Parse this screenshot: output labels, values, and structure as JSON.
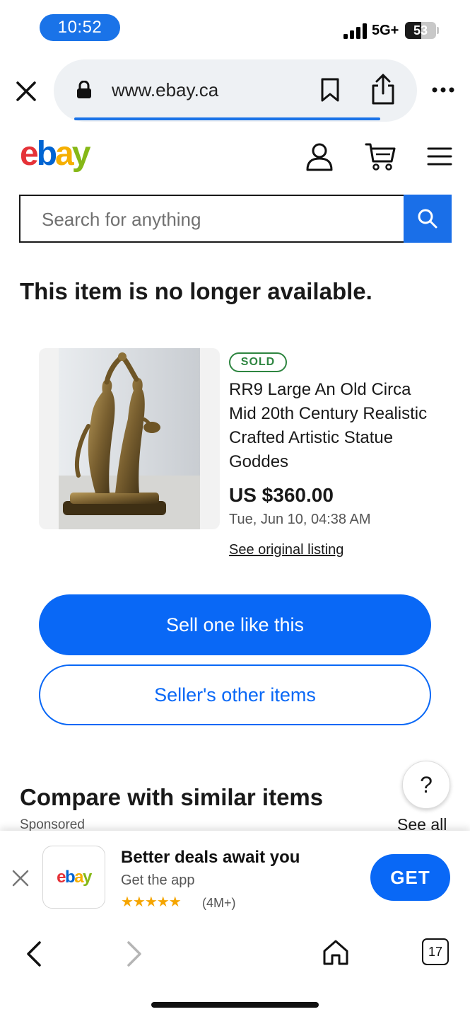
{
  "status_bar": {
    "time": "10:52",
    "network": "5G+",
    "battery": "53",
    "battery_level": 0.53
  },
  "browser": {
    "url": "www.ebay.ca"
  },
  "header": {
    "logo_letters": [
      {
        "char": "e",
        "color": "#e53238"
      },
      {
        "char": "b",
        "color": "#0064d2"
      },
      {
        "char": "a",
        "color": "#f5af02"
      },
      {
        "char": "y",
        "color": "#86b817"
      }
    ]
  },
  "search": {
    "placeholder": "Search for anything"
  },
  "page": {
    "title": "This item is no longer available."
  },
  "item": {
    "badge": "SOLD",
    "title": "RR9 Large An Old Circa Mid 20th Century Realistic Crafted Artistic Statue Goddes",
    "price": "US $360.00",
    "date": "Tue, Jun 10, 04:38 AM",
    "link": "See original listing"
  },
  "actions": {
    "sell": "Sell one like this",
    "other": "Seller's other items"
  },
  "compare": {
    "title": "Compare with similar items",
    "sponsored": "Sponsored",
    "see_all": "See all",
    "help": "?"
  },
  "app_banner": {
    "title": "Better deals await you",
    "subtitle": "Get the app",
    "stars": "★★★★★",
    "rating_count": "(4M+)",
    "get": "GET"
  },
  "toolbar": {
    "tab_count": "17"
  },
  "colors": {
    "accent": "#0968f6",
    "sold_green": "#2e8540",
    "star": "#f5a500"
  }
}
